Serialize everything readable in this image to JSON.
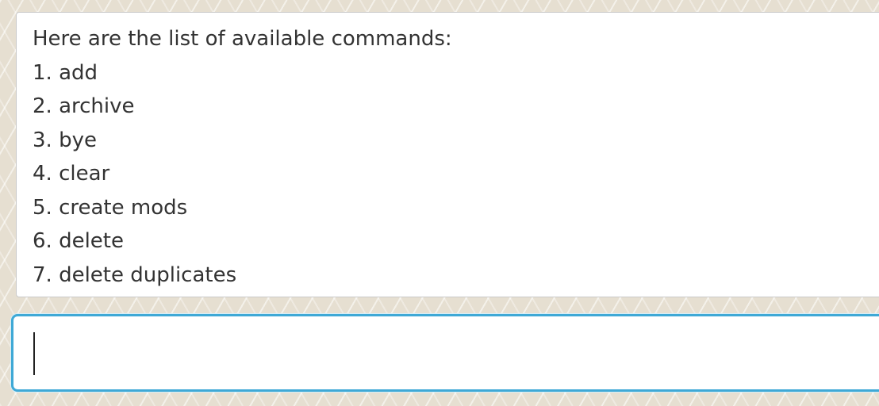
{
  "result_display": {
    "lines": [
      "Here are the list of available commands:",
      "1. add",
      "2. archive",
      "3. bye",
      "4. clear",
      "5. create mods",
      "6. delete",
      "7. delete duplicates"
    ]
  },
  "command_box": {
    "value": ""
  }
}
